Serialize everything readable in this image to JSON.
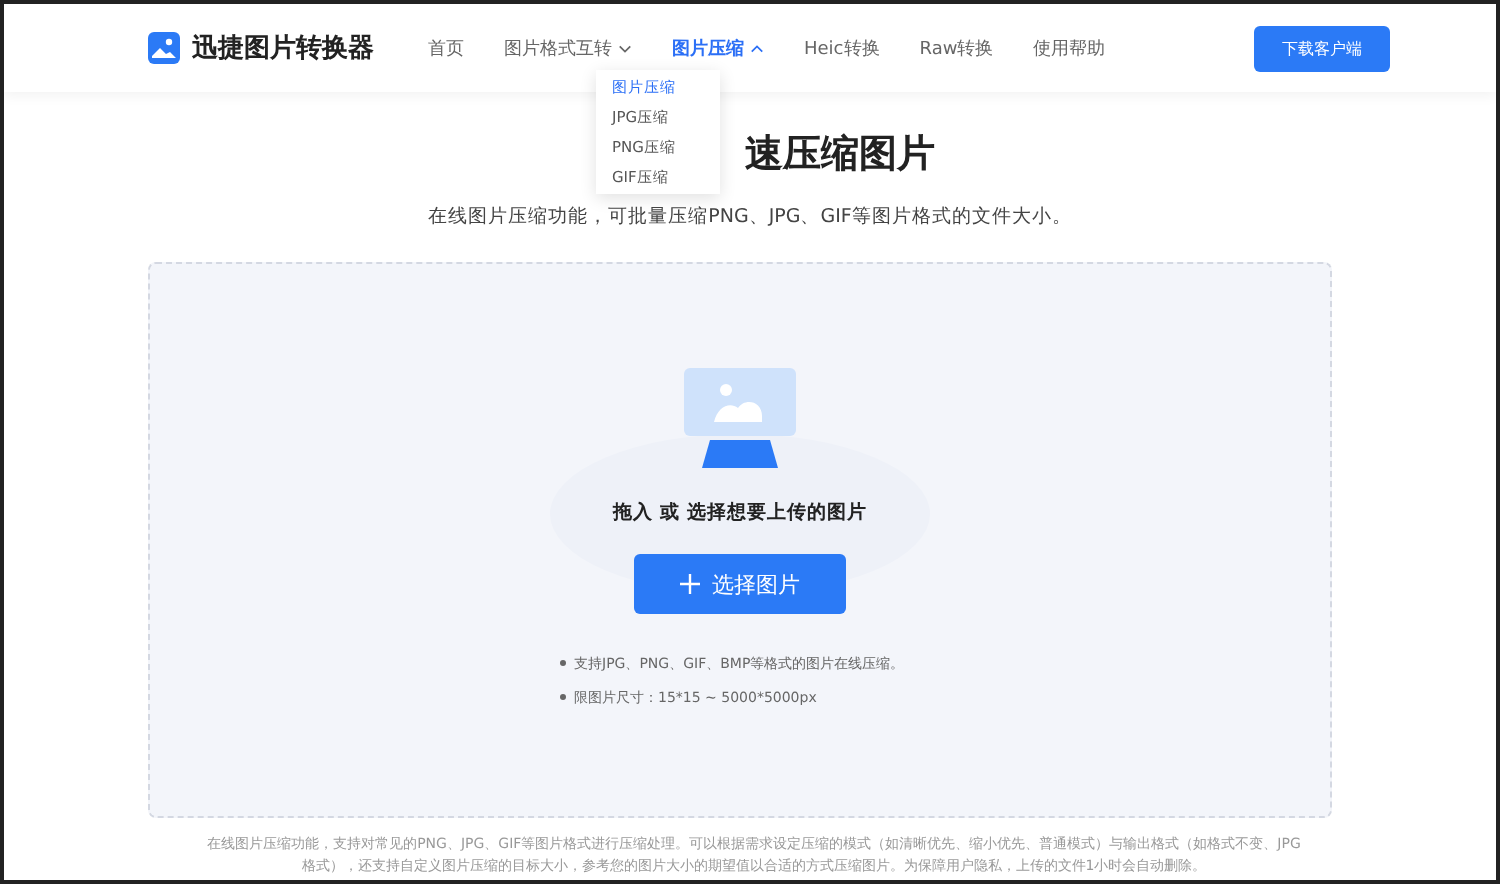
{
  "header": {
    "logo": "迅捷图片转换器",
    "nav": [
      {
        "label": "首页",
        "selected": false
      },
      {
        "label": "图片格式互转",
        "selected": false,
        "expanded": false
      },
      {
        "label": "图片压缩",
        "selected": true,
        "expanded": true
      },
      {
        "label": "Heic转换",
        "selected": false
      },
      {
        "label": "Raw转换",
        "selected": false
      },
      {
        "label": "使用帮助",
        "selected": false
      }
    ],
    "download_button": "下载客户端"
  },
  "dropdown": {
    "items": [
      {
        "label": "图片压缩",
        "selected": true
      },
      {
        "label": "JPG压缩",
        "selected": false
      },
      {
        "label": "PNG压缩",
        "selected": false
      },
      {
        "label": "GIF压缩",
        "selected": false
      }
    ]
  },
  "title": "速压缩图片",
  "subtitle": "在线图片压缩功能，可批量压缩PNG、JPG、GIF等图片格式的文件大小。",
  "upload": {
    "prompt": "拖入 或 选择想要上传的图片",
    "button": "选择图片",
    "notes": [
      "支持JPG、PNG、GIF、BMP等格式的图片在线压缩。",
      "限图片尺寸：15*15 ~ 5000*5000px"
    ]
  },
  "footer": "在线图片压缩功能，支持对常见的PNG、JPG、GIF等图片格式进行压缩处理。可以根据需求设定压缩的模式（如清晰优先、缩小优先、普通模式）与输出格式（如格式不变、JPG格式），还支持自定义图片压缩的目标大小，参考您的图片大小的期望值以合适的方式压缩图片。为保障用户隐私，上传的文件1小时会自动删除。"
}
